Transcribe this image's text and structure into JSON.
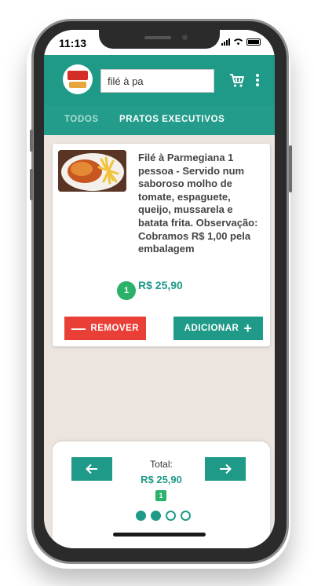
{
  "status_bar": {
    "time": "11:13"
  },
  "header": {
    "search_value": "filé à pa",
    "icons": [
      "cart-icon",
      "more-vertical-icon"
    ]
  },
  "tabs": [
    {
      "label": "TODOS",
      "active": false
    },
    {
      "label": "PRATOS EXECUTIVOS",
      "active": true
    }
  ],
  "product": {
    "description": "Filé à Parmegiana 1 pessoa - Servido num saboroso molho de tomate, espaguete, queijo, mussarela e batata frita. Observação: Cobramos R$ 1,00 pela embalagem",
    "quantity": "1",
    "price": "R$ 25,90",
    "remove_label": "REMOVER",
    "add_label": "ADICIONAR"
  },
  "footer": {
    "total_label": "Total:",
    "total_value": "R$ 25,90",
    "total_count": "1",
    "page_indicator": {
      "count": 4,
      "active": [
        0,
        1
      ]
    }
  },
  "colors": {
    "primary": "#1f9a88",
    "danger": "#ea3f37",
    "badge": "#2ab26a",
    "background": "#ebe4df"
  }
}
